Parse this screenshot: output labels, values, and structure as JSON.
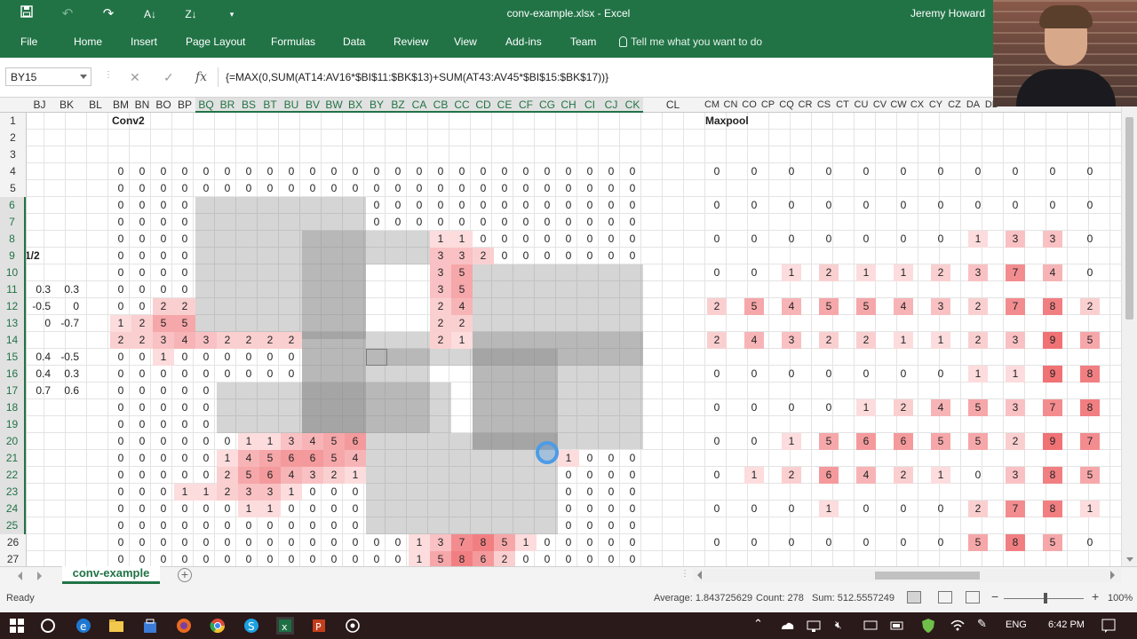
{
  "window": {
    "title": "conv-example.xlsx  -  Excel",
    "user": "Jeremy Howard"
  },
  "qat": {
    "save_icon": "save-icon",
    "undo_icon": "undo-icon",
    "redo_icon": "redo-icon",
    "sort_asc_icon": "sort-ascending-icon",
    "sort_desc_icon": "sort-descending-icon",
    "customize_icon": "customize-qat-icon"
  },
  "ribbon": {
    "tabs": [
      "File",
      "Home",
      "Insert",
      "Page Layout",
      "Formulas",
      "Data",
      "Review",
      "View",
      "Add-ins",
      "Team"
    ],
    "tellme": "Tell me what you want to do"
  },
  "formula_bar": {
    "name_box": "BY15",
    "cancel": "✕",
    "enter": "✓",
    "fx": "fx",
    "formula": "{=MAX(0,SUM(AT14:AV16*$BI$11:$BK$13)+SUM(AT43:AV45*$BI$15:$BK$17))}"
  },
  "columns_left": [
    "BJ",
    "BK",
    "BL",
    "BM",
    "BN",
    "BO",
    "BP",
    "BQ",
    "BR",
    "BS",
    "BT",
    "BU",
    "BV",
    "BW",
    "BX",
    "BY",
    "BZ",
    "CA",
    "CB",
    "CC",
    "CD",
    "CE",
    "CF",
    "CG",
    "CH",
    "CI",
    "CJ",
    "CK"
  ],
  "column_cl": "CL",
  "columns_right": [
    "CM",
    "CN",
    "CO",
    "CP",
    "CQ",
    "CR",
    "CS",
    "CT",
    "CU",
    "CV",
    "CW",
    "CX",
    "CY",
    "CZ",
    "DA",
    "DB"
  ],
  "rows": [
    "1",
    "2",
    "3",
    "4",
    "5",
    "6",
    "7",
    "8",
    "9",
    "10",
    "11",
    "12",
    "13",
    "14",
    "15",
    "16",
    "17",
    "18",
    "19",
    "20",
    "21",
    "22",
    "23",
    "24",
    "25",
    "26",
    "27"
  ],
  "labels": {
    "conv2": "Conv2",
    "maxpool": "Maxpool",
    "half": "1/2"
  },
  "filters": [
    {
      "row": 11,
      "a": "0.3",
      "b": "0.3"
    },
    {
      "row": 12,
      "a": "-0.5",
      "b": "0"
    },
    {
      "row": 13,
      "a": "0",
      "b": "-0.7"
    },
    {
      "row": 15,
      "a": "0.4",
      "b": "-0.5"
    },
    {
      "row": 16,
      "a": "0.4",
      "b": "0.3"
    },
    {
      "row": 17,
      "a": "0.7",
      "b": "0.6"
    }
  ],
  "conv": {
    "4": [
      "0",
      "0",
      "0",
      "0",
      "0",
      "0",
      "0",
      "0",
      "0",
      "0",
      "0",
      "0",
      "0",
      "0",
      "0",
      "0",
      "0",
      "0",
      "0",
      "0",
      "0",
      "0",
      "0",
      "0",
      "0"
    ],
    "5": [
      "0",
      "0",
      "0",
      "0",
      "0",
      "0",
      "0",
      "0",
      "0",
      "0",
      "0",
      "0",
      "0",
      "0",
      "0",
      "0",
      "0",
      "0",
      "0",
      "0",
      "0",
      "0",
      "0",
      "0",
      "0"
    ],
    "6": [
      "0",
      "0",
      "0",
      "0",
      "",
      "",
      "",
      "",
      "",
      "",
      "",
      "",
      "0",
      "0",
      "0",
      "0",
      "0",
      "0",
      "0",
      "0",
      "0",
      "0",
      "0",
      "0",
      "0"
    ],
    "7": [
      "0",
      "0",
      "0",
      "0",
      "",
      "",
      "",
      "",
      "",
      "",
      "",
      "",
      "0",
      "0",
      "0",
      "0",
      "0",
      "0",
      "0",
      "0",
      "0",
      "0",
      "0",
      "0",
      "0"
    ],
    "8": [
      "0",
      "0",
      "0",
      "0",
      "",
      "",
      "",
      "",
      "",
      "",
      "",
      "",
      "",
      "",
      "",
      "1",
      "1",
      "0",
      "0",
      "0",
      "0",
      "0",
      "0",
      "0",
      "0"
    ],
    "9": [
      "0",
      "0",
      "0",
      "0",
      "",
      "",
      "",
      "",
      "",
      "",
      "",
      "",
      "",
      "",
      "",
      "3",
      "3",
      "2",
      "0",
      "0",
      "0",
      "0",
      "0",
      "0",
      "0"
    ],
    "10": [
      "0",
      "0",
      "0",
      "0",
      "",
      "",
      "",
      "",
      "",
      "",
      "",
      "",
      "",
      "",
      "",
      "3",
      "5",
      "",
      "",
      "",
      "",
      "",
      "",
      "",
      ""
    ],
    "11": [
      "0",
      "0",
      "0",
      "0",
      "",
      "",
      "",
      "",
      "",
      "",
      "",
      "",
      "",
      "",
      "",
      "3",
      "5",
      "",
      "",
      "",
      "",
      "",
      "",
      "",
      ""
    ],
    "12": [
      "0",
      "0",
      "2",
      "2",
      "",
      "",
      "",
      "",
      "",
      "",
      "",
      "",
      "",
      "",
      "",
      "2",
      "4",
      "",
      "",
      "",
      "",
      "",
      "",
      "",
      ""
    ],
    "13": [
      "1",
      "2",
      "5",
      "5",
      "",
      "",
      "",
      "",
      "",
      "",
      "",
      "",
      "",
      "",
      "",
      "2",
      "2",
      "",
      "",
      "",
      "",
      "",
      "",
      "",
      ""
    ],
    "14": [
      "2",
      "2",
      "3",
      "4",
      "3",
      "2",
      "2",
      "2",
      "2",
      "",
      "",
      "",
      "",
      "",
      "",
      "2",
      "1",
      "",
      "",
      "",
      "",
      "",
      "",
      "",
      ""
    ],
    "15": [
      "0",
      "0",
      "1",
      "0",
      "0",
      "0",
      "0",
      "0",
      "0",
      "",
      "",
      "",
      "",
      "",
      "",
      "",
      "",
      "",
      "",
      "",
      "",
      "",
      "",
      "",
      ""
    ],
    "16": [
      "0",
      "0",
      "0",
      "0",
      "0",
      "0",
      "0",
      "0",
      "0",
      "",
      "",
      "",
      "",
      "",
      "",
      "",
      "",
      "",
      "",
      "",
      "",
      "",
      "",
      "",
      ""
    ],
    "17": [
      "0",
      "0",
      "0",
      "0",
      "0",
      "",
      "",
      "",
      "",
      "",
      "",
      "",
      "",
      "",
      "",
      "",
      "",
      "",
      "",
      "",
      "",
      "",
      "",
      "",
      ""
    ],
    "18": [
      "0",
      "0",
      "0",
      "0",
      "0",
      "",
      "",
      "",
      "",
      "",
      "",
      "",
      "",
      "",
      "",
      "",
      "",
      "",
      "",
      "",
      "",
      "",
      "",
      "",
      ""
    ],
    "19": [
      "0",
      "0",
      "0",
      "0",
      "0",
      "",
      "",
      "",
      "",
      "",
      "",
      "",
      "",
      "",
      "",
      "",
      "",
      "",
      "",
      "",
      "",
      "",
      "",
      "",
      ""
    ],
    "20": [
      "0",
      "0",
      "0",
      "0",
      "0",
      "0",
      "1",
      "1",
      "3",
      "4",
      "5",
      "6",
      "",
      "",
      "",
      "",
      "",
      "",
      "",
      "",
      "",
      "",
      "",
      "",
      ""
    ],
    "21": [
      "0",
      "0",
      "0",
      "0",
      "0",
      "1",
      "4",
      "5",
      "6",
      "6",
      "5",
      "4",
      "",
      "",
      "",
      "",
      "",
      "",
      "",
      "",
      "",
      "1",
      "0",
      "0",
      "0"
    ],
    "22": [
      "0",
      "0",
      "0",
      "0",
      "0",
      "2",
      "5",
      "6",
      "4",
      "3",
      "2",
      "1",
      "",
      "",
      "",
      "",
      "",
      "",
      "",
      "",
      "",
      "0",
      "0",
      "0",
      "0"
    ],
    "23": [
      "0",
      "0",
      "0",
      "1",
      "1",
      "2",
      "3",
      "3",
      "1",
      "0",
      "0",
      "0",
      "",
      "",
      "",
      "",
      "",
      "",
      "",
      "",
      "",
      "0",
      "0",
      "0",
      "0"
    ],
    "24": [
      "0",
      "0",
      "0",
      "0",
      "0",
      "0",
      "1",
      "1",
      "0",
      "0",
      "0",
      "0",
      "",
      "",
      "",
      "",
      "",
      "",
      "",
      "",
      "",
      "0",
      "0",
      "0",
      "0"
    ],
    "25": [
      "0",
      "0",
      "0",
      "0",
      "0",
      "0",
      "0",
      "0",
      "0",
      "0",
      "0",
      "0",
      "",
      "",
      "",
      "",
      "",
      "",
      "",
      "",
      "",
      "0",
      "0",
      "0",
      "0"
    ],
    "26": [
      "0",
      "0",
      "0",
      "0",
      "0",
      "0",
      "0",
      "0",
      "0",
      "0",
      "0",
      "0",
      "0",
      "0",
      "1",
      "3",
      "7",
      "8",
      "5",
      "1",
      "0",
      "0",
      "0",
      "0",
      "0"
    ],
    "27": [
      "0",
      "0",
      "0",
      "0",
      "0",
      "0",
      "0",
      "0",
      "0",
      "0",
      "0",
      "0",
      "0",
      "0",
      "1",
      "5",
      "8",
      "6",
      "2",
      "0",
      "0",
      "0",
      "0",
      "0",
      "0"
    ]
  },
  "maxpool": {
    "4": [
      "0",
      "0",
      "0",
      "0",
      "0",
      "0",
      "0",
      "0",
      "0",
      "0",
      "0"
    ],
    "6": [
      "0",
      "0",
      "0",
      "0",
      "0",
      "0",
      "0",
      "0",
      "0",
      "0",
      "0"
    ],
    "8": [
      "0",
      "0",
      "0",
      "0",
      "0",
      "0",
      "0",
      "1",
      "3",
      "3",
      "0"
    ],
    "10": [
      "0",
      "0",
      "1",
      "2",
      "1",
      "1",
      "2",
      "3",
      "7",
      "4",
      "0"
    ],
    "12": [
      "2",
      "5",
      "4",
      "5",
      "5",
      "4",
      "3",
      "2",
      "7",
      "8",
      "2"
    ],
    "14": [
      "2",
      "4",
      "3",
      "2",
      "2",
      "1",
      "1",
      "2",
      "3",
      "9",
      "5"
    ],
    "16": [
      "0",
      "0",
      "0",
      "0",
      "0",
      "0",
      "0",
      "1",
      "1",
      "9",
      "8"
    ],
    "18": [
      "0",
      "0",
      "0",
      "0",
      "1",
      "2",
      "4",
      "5",
      "3",
      "7",
      "8"
    ],
    "20": [
      "0",
      "0",
      "1",
      "5",
      "6",
      "6",
      "5",
      "5",
      "2",
      "9",
      "7"
    ],
    "22": [
      "0",
      "1",
      "2",
      "6",
      "4",
      "2",
      "1",
      "0",
      "3",
      "8",
      "5"
    ],
    "24": [
      "0",
      "0",
      "0",
      "1",
      "0",
      "0",
      "0",
      "2",
      "7",
      "8",
      "1"
    ],
    "26": [
      "0",
      "0",
      "0",
      "0",
      "0",
      "0",
      "0",
      "5",
      "8",
      "5",
      "0"
    ]
  },
  "sheet_tab": "conv-example",
  "status": {
    "ready": "Ready",
    "average": "Average: 1.843725629",
    "count": "Count: 278",
    "sum": "Sum: 512.5557249",
    "zoom": "100%",
    "zoom_minus": "−",
    "zoom_plus": "+"
  },
  "taskbar": {
    "lang": "ENG",
    "time": "6:42 PM"
  },
  "colors": {
    "excel_green": "#217346",
    "heat_low": "#fde9ea",
    "heat_high": "#f07275"
  }
}
